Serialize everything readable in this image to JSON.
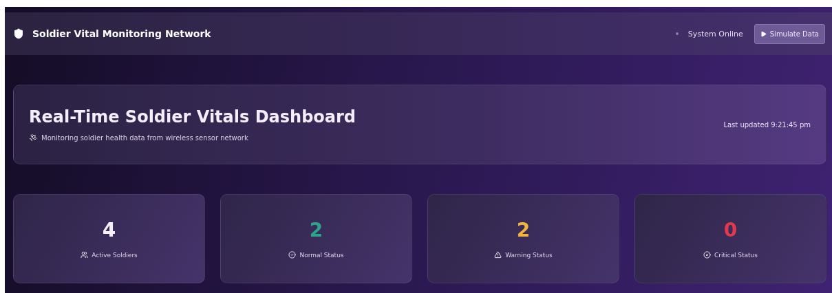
{
  "navbar": {
    "title": "Soldier Vital Monitoring Network",
    "status": "System Online",
    "button": "Simulate Data"
  },
  "header": {
    "title": "Real-Time Soldier Vitals Dashboard",
    "subtitle": "Monitoring soldier health data from wireless sensor network",
    "updated": "Last updated 9:21:45 pm"
  },
  "stats": [
    {
      "kind": "soldiers",
      "value": "4",
      "label": "Active Soldiers",
      "color": "#f4f0f8"
    },
    {
      "kind": "normal",
      "value": "2",
      "label": "Normal Status",
      "color": "#2aa58a"
    },
    {
      "kind": "warning",
      "value": "2",
      "label": "Warning Status",
      "color": "#f2b53a"
    },
    {
      "kind": "critical",
      "value": "0",
      "label": "Critical Status",
      "color": "#e23a4c"
    }
  ]
}
